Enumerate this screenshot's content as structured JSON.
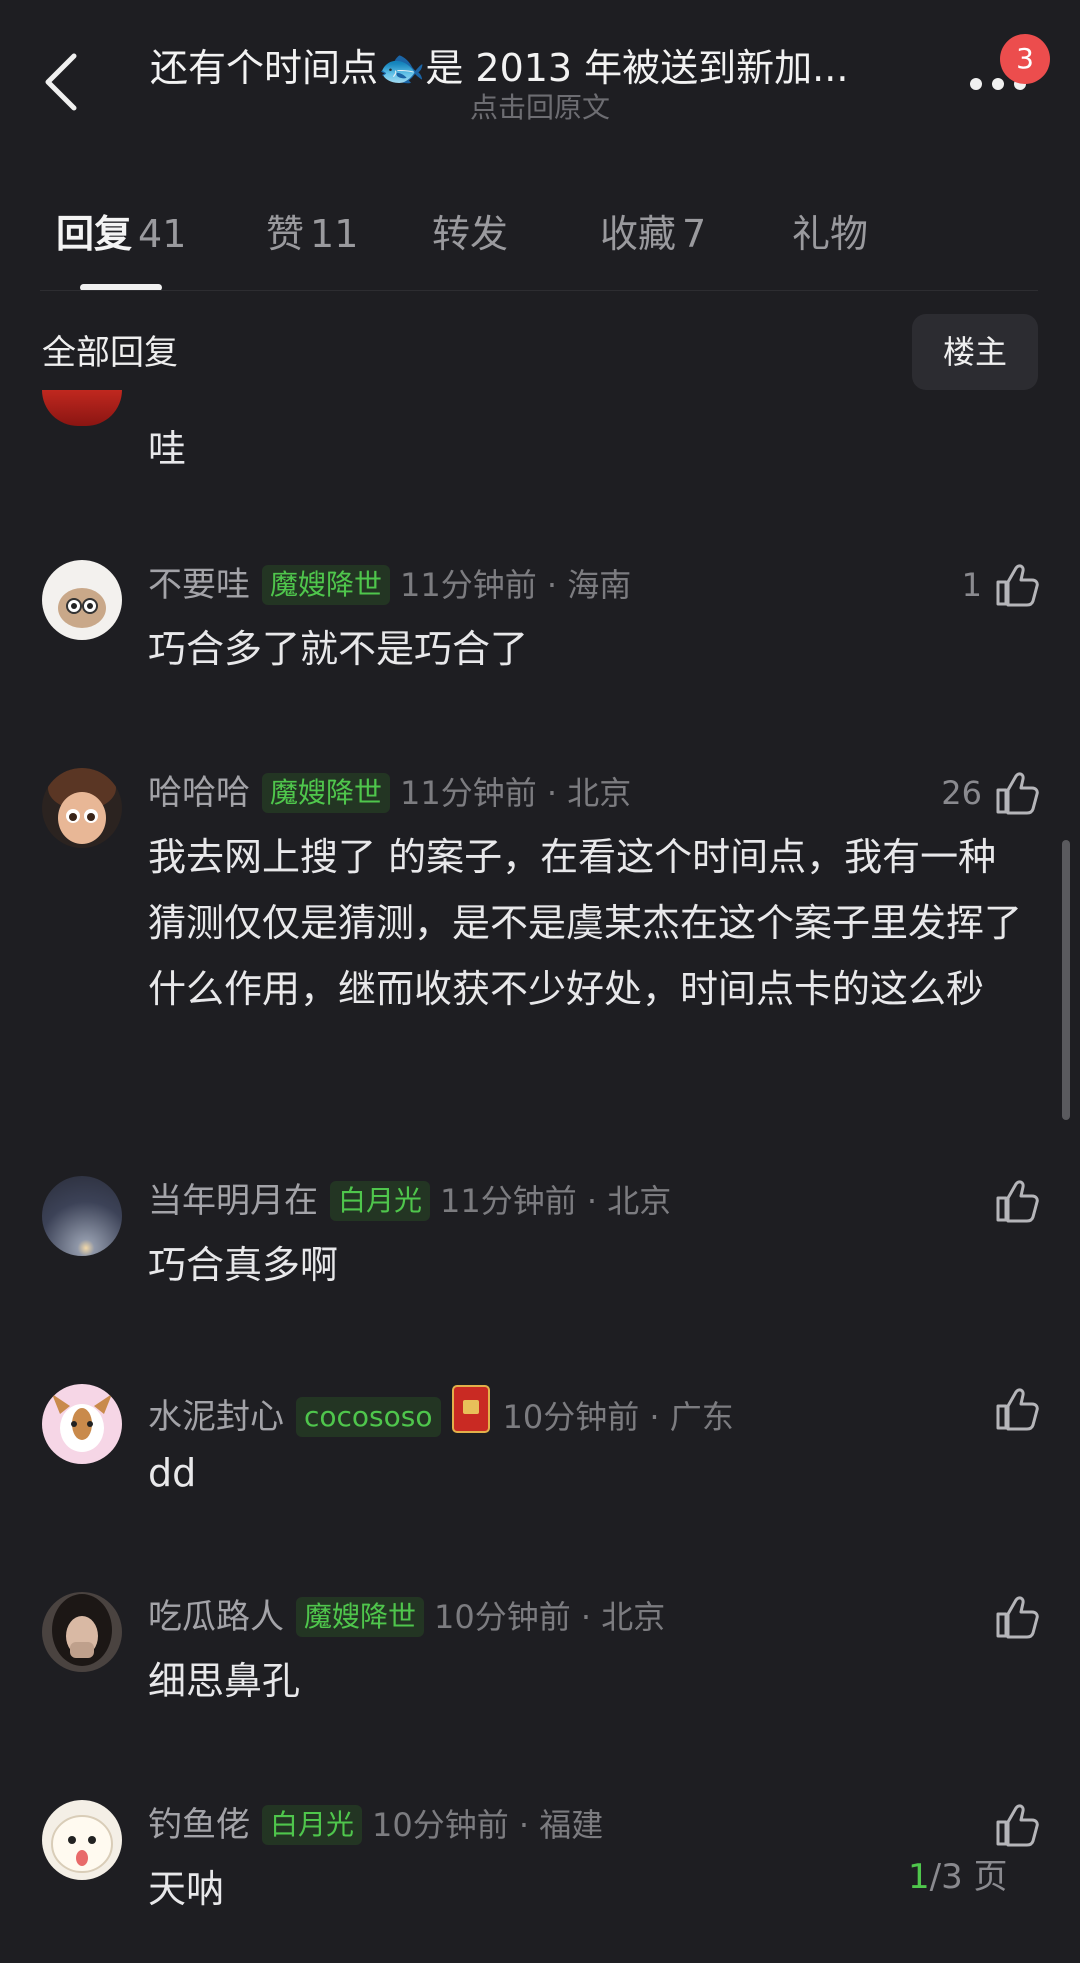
{
  "header": {
    "title": "还有个时间点🐟是 2013 年被送到新加...",
    "subtitle": "点击回原文",
    "badge_count": "3"
  },
  "tabs": [
    {
      "name": "回复",
      "count": "41"
    },
    {
      "name": "赞",
      "count": "11"
    },
    {
      "name": "转发",
      "count": ""
    },
    {
      "name": "收藏",
      "count": "7"
    },
    {
      "name": "礼物",
      "count": ""
    }
  ],
  "section": {
    "title": "全部回复",
    "owner_button": "楼主"
  },
  "comments": [
    {
      "username": "",
      "tag": "",
      "time": "",
      "likes": "",
      "text": "哇"
    },
    {
      "username": "不要哇",
      "tag": "魔嫂降世",
      "time": "11分钟前 · 海南",
      "likes": "1",
      "text": "巧合多了就不是巧合了"
    },
    {
      "username": "哈哈哈",
      "tag": "魔嫂降世",
      "time": "11分钟前 · 北京",
      "likes": "26",
      "text": "我去网上搜了   的案子，在看这个时间点，我有一种猜测仅仅是猜测，是不是虞某杰在这个案子里发挥了什么作用，继而收获不少好处，时间点卡的这么秒"
    },
    {
      "username": "当年明月在",
      "tag": "白月光",
      "time": "11分钟前 · 北京",
      "likes": "",
      "text": "巧合真多啊"
    },
    {
      "username": "水泥封心",
      "tag": "cocososo",
      "time": "10分钟前 · 广东",
      "likes": "",
      "text": "dd"
    },
    {
      "username": "吃瓜路人",
      "tag": "魔嫂降世",
      "time": "10分钟前 · 北京",
      "likes": "",
      "text": "细思鼻孔"
    },
    {
      "username": "钓鱼佬",
      "tag": "白月光",
      "time": "10分钟前 · 福建",
      "likes": "",
      "text": "天呐"
    }
  ],
  "pager": {
    "current": "1",
    "total": "/3 页"
  },
  "colors": {
    "background": "#1e1e22",
    "tag_green": "#4fc64c",
    "badge_red": "#ec4d4d"
  }
}
